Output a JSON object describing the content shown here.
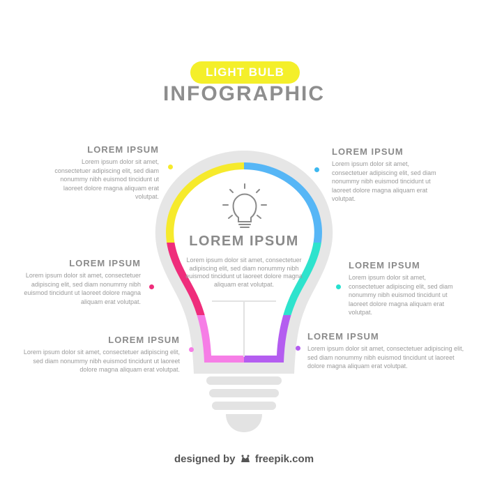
{
  "header": {
    "badge": "LIGHT BULB",
    "title": "INFOGRAPHIC"
  },
  "center": {
    "title": "LOREM IPSUM",
    "body": "Lorem ipsum dolor sit amet, consectetuer adipiscing elit, sed diam nonummy nibh euismod tincidunt ut laoreet dolore magna aliquam erat volutpat."
  },
  "items": [
    {
      "title": "LOREM IPSUM",
      "body": "Lorem ipsum dolor sit amet, consectetuer adipiscing elit, sed diam nonummy nibh euismod tincidunt ut laoreet dolore magna aliquam erat volutpat.",
      "color": "#f6ea2c"
    },
    {
      "title": "LOREM IPSUM",
      "body": "Lorem ipsum dolor sit amet, consectetuer adipiscing elit, sed diam nonummy nibh euismod tincidunt ut laoreet dolore magna aliquam erat volutpat.",
      "color": "#3db8f0"
    },
    {
      "title": "LOREM IPSUM",
      "body": "Lorem ipsum dolor sit amet, consectetuer adipiscing elit, sed diam nonummy nibh euismod tincidunt ut laoreet dolore magna aliquam erat volutpat.",
      "color": "#ef2d7b"
    },
    {
      "title": "LOREM IPSUM",
      "body": "Lorem ipsum dolor sit amet, consectetuer adipiscing elit, sed diam nonummy nibh euismod tincidunt ut laoreet dolore magna aliquam erat volutpat.",
      "color": "#27e0cf"
    },
    {
      "title": "LOREM IPSUM",
      "body": "Lorem ipsum dolor sit amet, consectetuer adipiscing elit, sed diam nonummy nibh euismod tincidunt ut laoreet dolore magna aliquam erat volutpat.",
      "color": "#f67ee6"
    },
    {
      "title": "LOREM IPSUM",
      "body": "Lorem ipsum dolor sit amet, consectetuer adipiscing elit, sed diam nonummy nibh euismod tincidunt ut laoreet dolore magna aliquam erat volutpat.",
      "color": "#b45df0"
    }
  ],
  "footer": {
    "prefix": "designed by",
    "brand": "freepik.com"
  }
}
